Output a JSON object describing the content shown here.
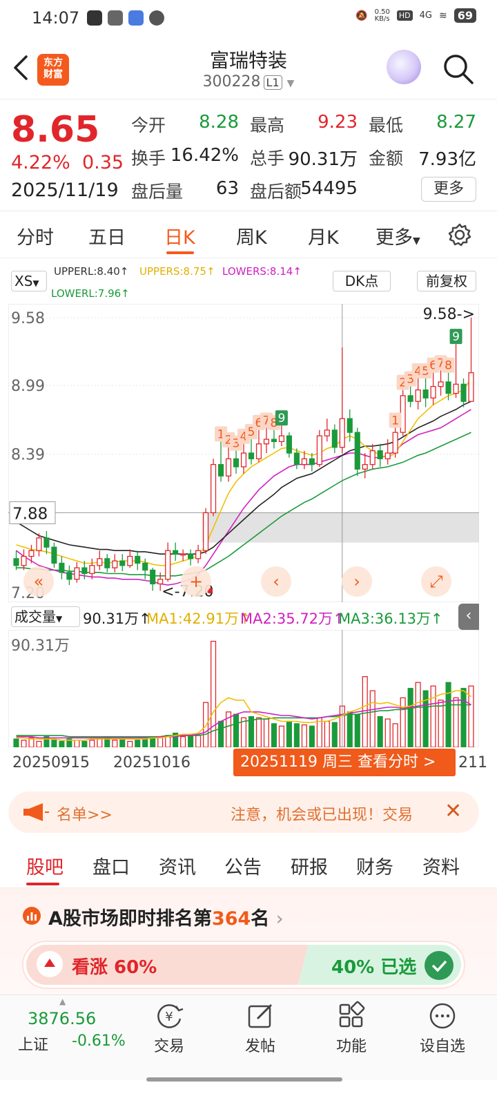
{
  "status_bar": {
    "time": "14:07",
    "net_speed": "0.50\nKB/s",
    "hd": "HD",
    "signal": "4G",
    "battery": "69"
  },
  "header": {
    "logo_text_1": "东方",
    "logo_text_2": "财富",
    "title": "富瑞特装",
    "code": "300228",
    "level": "L1"
  },
  "quote": {
    "price": "8.65",
    "change_pct": "4.22%",
    "change_abs": "0.35",
    "date": "2025/11/19",
    "open_label": "今开",
    "open": "8.28",
    "high_label": "最高",
    "high": "9.23",
    "low_label": "最低",
    "low": "8.27",
    "turnover_label": "换手",
    "turnover": "16.42%",
    "volume_label": "总手",
    "volume": "90.31万",
    "amount_label": "金额",
    "amount": "7.93亿",
    "after_vol_label": "盘后量",
    "after_vol": "63",
    "after_amt_label": "盘后额",
    "after_amt": "54495",
    "more_label": "更多"
  },
  "period_tabs": [
    "分时",
    "五日",
    "日K",
    "周K",
    "月K",
    "更多"
  ],
  "indicator": {
    "main_select": "XS",
    "upperl": "UPPERL:8.40↑",
    "uppers": "UPPERS:8.75↑",
    "lowers": "LOWERS:8.14↑",
    "lowerl": "LOWERL:7.96↑",
    "dk_label": "DK点",
    "adjust_label": "前复权"
  },
  "chart_data": {
    "type": "candlestick",
    "y_ticks": [
      "9.58",
      "8.99",
      "8.39",
      "7.20"
    ],
    "current_price_line": "7.88",
    "max_marker": "9.58->",
    "min_marker": "<-7.20",
    "candles": [
      [
        7.48,
        7.42,
        7.55,
        7.38
      ],
      [
        7.42,
        7.5,
        7.56,
        7.38
      ],
      [
        7.5,
        7.55,
        7.6,
        7.44
      ],
      [
        7.55,
        7.66,
        7.7,
        7.5
      ],
      [
        7.66,
        7.58,
        7.72,
        7.52
      ],
      [
        7.58,
        7.44,
        7.62,
        7.4
      ],
      [
        7.44,
        7.36,
        7.5,
        7.3
      ],
      [
        7.36,
        7.3,
        7.42,
        7.25
      ],
      [
        7.3,
        7.4,
        7.45,
        7.27
      ],
      [
        7.4,
        7.35,
        7.46,
        7.3
      ],
      [
        7.35,
        7.42,
        7.48,
        7.3
      ],
      [
        7.42,
        7.48,
        7.55,
        7.38
      ],
      [
        7.48,
        7.4,
        7.52,
        7.36
      ],
      [
        7.4,
        7.46,
        7.52,
        7.36
      ],
      [
        7.46,
        7.42,
        7.52,
        7.37
      ],
      [
        7.42,
        7.5,
        7.56,
        7.4
      ],
      [
        7.5,
        7.44,
        7.55,
        7.38
      ],
      [
        7.44,
        7.38,
        7.48,
        7.3
      ],
      [
        7.38,
        7.26,
        7.4,
        7.2
      ],
      [
        7.26,
        7.3,
        7.36,
        7.2
      ],
      [
        7.3,
        7.55,
        7.62,
        7.28
      ],
      [
        7.55,
        7.52,
        7.62,
        7.46
      ],
      [
        7.52,
        7.52,
        7.56,
        7.46
      ],
      [
        7.52,
        7.48,
        7.56,
        7.42
      ],
      [
        7.48,
        7.55,
        7.6,
        7.44
      ],
      [
        7.55,
        7.88,
        7.92,
        7.52
      ],
      [
        7.88,
        8.3,
        8.35,
        7.85
      ],
      [
        8.3,
        8.2,
        8.5,
        8.15
      ],
      [
        8.2,
        8.35,
        8.45,
        8.15
      ],
      [
        8.35,
        8.28,
        8.42,
        8.22
      ],
      [
        8.28,
        8.4,
        8.48,
        8.22
      ],
      [
        8.4,
        8.35,
        8.52,
        8.3
      ],
      [
        8.35,
        8.48,
        8.6,
        8.32
      ],
      [
        8.48,
        8.52,
        8.62,
        8.4
      ],
      [
        8.52,
        8.5,
        8.6,
        8.44
      ],
      [
        8.5,
        8.55,
        8.64,
        8.46
      ],
      [
        8.55,
        8.4,
        8.58,
        8.36
      ],
      [
        8.4,
        8.3,
        8.44,
        8.26
      ],
      [
        8.3,
        8.35,
        8.42,
        8.26
      ],
      [
        8.35,
        8.3,
        8.4,
        8.24
      ],
      [
        8.3,
        8.55,
        8.6,
        8.28
      ],
      [
        8.55,
        8.6,
        8.7,
        8.5
      ],
      [
        8.6,
        8.45,
        8.65,
        8.4
      ],
      [
        8.45,
        8.7,
        9.32,
        8.4
      ],
      [
        8.7,
        8.58,
        8.78,
        8.5
      ],
      [
        8.58,
        8.26,
        8.62,
        8.2
      ],
      [
        8.26,
        8.3,
        8.4,
        8.18
      ],
      [
        8.3,
        8.42,
        8.48,
        8.26
      ],
      [
        8.42,
        8.35,
        8.48,
        8.28
      ],
      [
        8.35,
        8.4,
        8.52,
        8.3
      ],
      [
        8.4,
        8.58,
        8.62,
        8.36
      ],
      [
        8.58,
        8.9,
        8.95,
        8.55
      ],
      [
        8.9,
        8.85,
        8.98,
        8.8
      ],
      [
        8.85,
        8.95,
        9.05,
        8.78
      ],
      [
        8.95,
        8.88,
        9.05,
        8.8
      ],
      [
        8.88,
        8.98,
        9.1,
        8.82
      ],
      [
        8.98,
        9.02,
        9.12,
        8.9
      ],
      [
        9.02,
        8.92,
        9.1,
        8.86
      ],
      [
        8.92,
        9.0,
        9.35,
        8.88
      ],
      [
        9.0,
        8.85,
        9.05,
        8.8
      ],
      [
        8.85,
        9.1,
        9.58,
        8.9
      ]
    ],
    "ma_yellow": [
      7.6,
      7.58,
      7.56,
      7.55,
      7.54,
      7.52,
      7.5,
      7.48,
      7.46,
      7.44,
      7.44,
      7.45,
      7.44,
      7.45,
      7.46,
      7.46,
      7.46,
      7.45,
      7.43,
      7.42,
      7.42,
      7.44,
      7.46,
      7.48,
      7.5,
      7.6,
      7.75,
      7.9,
      8.05,
      8.15,
      8.22,
      8.28,
      8.32,
      8.36,
      8.4,
      8.44,
      8.45,
      8.42,
      8.4,
      8.38,
      8.4,
      8.44,
      8.46,
      8.52,
      8.55,
      8.52,
      8.46,
      8.42,
      8.38,
      8.36,
      8.4,
      8.5,
      8.6,
      8.7,
      8.76,
      8.82,
      8.86,
      8.9,
      8.92,
      8.95,
      9.05
    ],
    "ma_black": [
      7.8,
      7.76,
      7.72,
      7.68,
      7.66,
      7.64,
      7.62,
      7.6,
      7.59,
      7.58,
      7.57,
      7.56,
      7.56,
      7.55,
      7.55,
      7.55,
      7.54,
      7.54,
      7.53,
      7.52,
      7.52,
      7.52,
      7.52,
      7.52,
      7.52,
      7.54,
      7.58,
      7.64,
      7.7,
      7.76,
      7.82,
      7.88,
      7.94,
      7.99,
      8.04,
      8.1,
      8.14,
      8.18,
      8.2,
      8.22,
      8.26,
      8.3,
      8.34,
      8.38,
      8.42,
      8.44,
      8.46,
      8.46,
      8.47,
      8.48,
      8.5,
      8.54,
      8.58,
      8.62,
      8.65,
      8.68,
      8.72,
      8.75,
      8.78,
      8.82,
      8.85
    ],
    "ma_magenta": [
      7.55,
      7.5,
      7.46,
      7.42,
      7.4,
      7.38,
      7.36,
      7.35,
      7.34,
      7.33,
      7.32,
      7.32,
      7.31,
      7.31,
      7.3,
      7.3,
      7.3,
      7.29,
      7.28,
      7.26,
      7.25,
      7.26,
      7.28,
      7.3,
      7.34,
      7.42,
      7.52,
      7.62,
      7.72,
      7.82,
      7.92,
      8.0,
      8.08,
      8.14,
      8.2,
      8.24,
      8.28,
      8.3,
      8.3,
      8.3,
      8.32,
      8.34,
      8.36,
      8.38,
      8.4,
      8.4,
      8.38,
      8.36,
      8.36,
      8.38,
      8.42,
      8.48,
      8.52,
      8.56,
      8.58,
      8.6,
      8.62,
      8.66,
      8.7,
      8.74,
      8.78
    ],
    "ma_green": [
      7.4,
      7.4,
      7.39,
      7.39,
      7.38,
      7.38,
      7.38,
      7.37,
      7.37,
      7.36,
      7.36,
      7.36,
      7.35,
      7.35,
      7.35,
      7.34,
      7.34,
      7.34,
      7.33,
      7.33,
      7.33,
      7.33,
      7.34,
      7.35,
      7.36,
      7.38,
      7.42,
      7.46,
      7.5,
      7.55,
      7.6,
      7.65,
      7.7,
      7.75,
      7.8,
      7.85,
      7.89,
      7.93,
      7.97,
      8.0,
      8.04,
      8.08,
      8.12,
      8.16,
      8.19,
      8.22,
      8.24,
      8.26,
      8.27,
      8.28,
      8.3,
      8.32,
      8.35,
      8.38,
      8.4,
      8.43,
      8.46,
      8.49,
      8.52,
      8.55,
      8.58
    ],
    "td_marks": [
      {
        "i": 27,
        "label": "1"
      },
      {
        "i": 28,
        "label": "2"
      },
      {
        "i": 29,
        "label": "3"
      },
      {
        "i": 30,
        "label": "4"
      },
      {
        "i": 31,
        "label": "5"
      },
      {
        "i": 32,
        "label": "6"
      },
      {
        "i": 33,
        "label": "7"
      },
      {
        "i": 34,
        "label": "8"
      },
      {
        "i": 35,
        "label": "9",
        "green": true
      },
      {
        "i": 50,
        "label": "1"
      },
      {
        "i": 51,
        "label": "2"
      },
      {
        "i": 52,
        "label": "3"
      },
      {
        "i": 53,
        "label": "4"
      },
      {
        "i": 54,
        "label": "5"
      },
      {
        "i": 55,
        "label": "6"
      },
      {
        "i": 56,
        "label": "7"
      },
      {
        "i": 57,
        "label": "8"
      },
      {
        "i": 58,
        "label": "9",
        "green": true
      }
    ],
    "volumes": [
      7,
      6,
      8,
      5,
      9,
      6,
      5,
      7,
      6,
      5,
      6,
      7,
      8,
      6,
      7,
      5,
      6,
      7,
      8,
      9,
      10,
      12,
      9,
      11,
      10,
      38,
      90,
      22,
      30,
      28,
      25,
      26,
      25,
      24,
      20,
      18,
      22,
      20,
      19,
      18,
      25,
      22,
      21,
      35,
      30,
      28,
      60,
      48,
      26,
      24,
      20,
      42,
      50,
      55,
      48,
      52,
      40,
      55,
      42,
      50,
      52
    ],
    "vol_ma1": [
      8,
      8,
      7,
      7,
      7,
      7,
      6,
      6,
      6,
      6,
      7,
      7,
      7,
      7,
      7,
      7,
      7,
      7,
      8,
      8,
      9,
      10,
      11,
      11,
      12,
      18,
      30,
      38,
      42,
      40,
      40,
      30,
      28,
      26,
      24,
      22,
      22,
      22,
      21,
      21,
      22,
      22,
      24,
      27,
      30,
      32,
      35,
      38,
      37,
      38,
      36,
      34,
      35,
      38,
      40,
      42,
      45,
      46,
      48,
      48,
      43
    ],
    "vol_ma2": [
      9,
      9,
      9,
      8,
      8,
      8,
      8,
      8,
      8,
      8,
      8,
      8,
      8,
      8,
      8,
      8,
      8,
      8,
      8,
      9,
      9,
      9,
      10,
      10,
      11,
      13,
      18,
      22,
      25,
      28,
      30,
      30,
      30,
      29,
      28,
      27,
      27,
      26,
      25,
      24,
      25,
      26,
      27,
      28,
      29,
      30,
      31,
      32,
      33,
      34,
      34,
      33,
      34,
      35,
      36,
      37,
      38,
      39,
      40,
      40,
      36
    ],
    "vol_ma3": [
      10,
      10,
      10,
      10,
      10,
      10,
      10,
      9,
      9,
      9,
      9,
      9,
      9,
      9,
      9,
      9,
      9,
      9,
      9,
      9,
      10,
      10,
      10,
      10,
      10,
      11,
      14,
      16,
      18,
      20,
      22,
      23,
      24,
      24,
      25,
      25,
      25,
      25,
      25,
      25,
      25,
      26,
      26,
      27,
      28,
      28,
      29,
      30,
      31,
      31,
      32,
      32,
      33,
      34,
      34,
      35,
      35,
      36,
      36,
      36,
      36
    ]
  },
  "volume_panel": {
    "select": "成交量",
    "vol": "90.31万↑",
    "ma1": "MA1:42.91万↑",
    "ma2": "MA2:35.72万↑",
    "ma3": "MA3:36.13万↑",
    "top_label": "90.31万"
  },
  "x_dates": [
    "20250915",
    "20251016"
  ],
  "x_date_partial": "211",
  "date_banner": "20251119 周三 查看分时 >",
  "alert": {
    "left": "名单>>",
    "right": "注意，机会或已出现！交易"
  },
  "section_tabs": [
    "股吧",
    "盘口",
    "资讯",
    "公告",
    "研报",
    "财务",
    "资料"
  ],
  "rank": {
    "prefix": "A股市场即时排名第",
    "number": "364",
    "suffix": "名"
  },
  "vote": {
    "up": "看涨 60%",
    "up_fraction": 0.6,
    "down": "40% 已选"
  },
  "bottom_nav": {
    "index_value": "3876.56",
    "index_name": "上证",
    "index_change": "-0.61%",
    "items": [
      "交易",
      "发帖",
      "功能",
      "设自选"
    ]
  },
  "colors": {
    "up": "#e0262b",
    "down": "#1a9a3a",
    "accent": "#f45a1d"
  }
}
